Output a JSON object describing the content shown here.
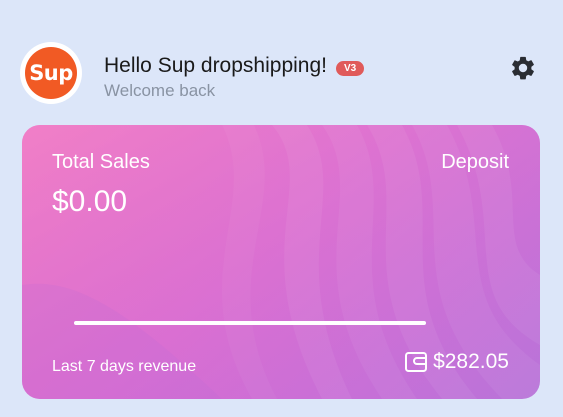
{
  "header": {
    "logo_text": "Sup",
    "greeting": "Hello Sup dropshipping!",
    "version_badge": "V3",
    "subtitle": "Welcome back",
    "settings_icon": "gear-icon"
  },
  "card": {
    "total_sales_label": "Total Sales",
    "total_sales_value": "$0.00",
    "deposit_label": "Deposit",
    "revenue_label": "Last 7 days revenue",
    "wallet_icon": "wallet-icon",
    "deposit_value": "$282.05"
  },
  "colors": {
    "background": "#dce6f9",
    "logo_orange": "#f15a24",
    "badge_red": "#e05a5a",
    "card_pink": "#e06cc8",
    "card_purple": "#b874d9"
  }
}
